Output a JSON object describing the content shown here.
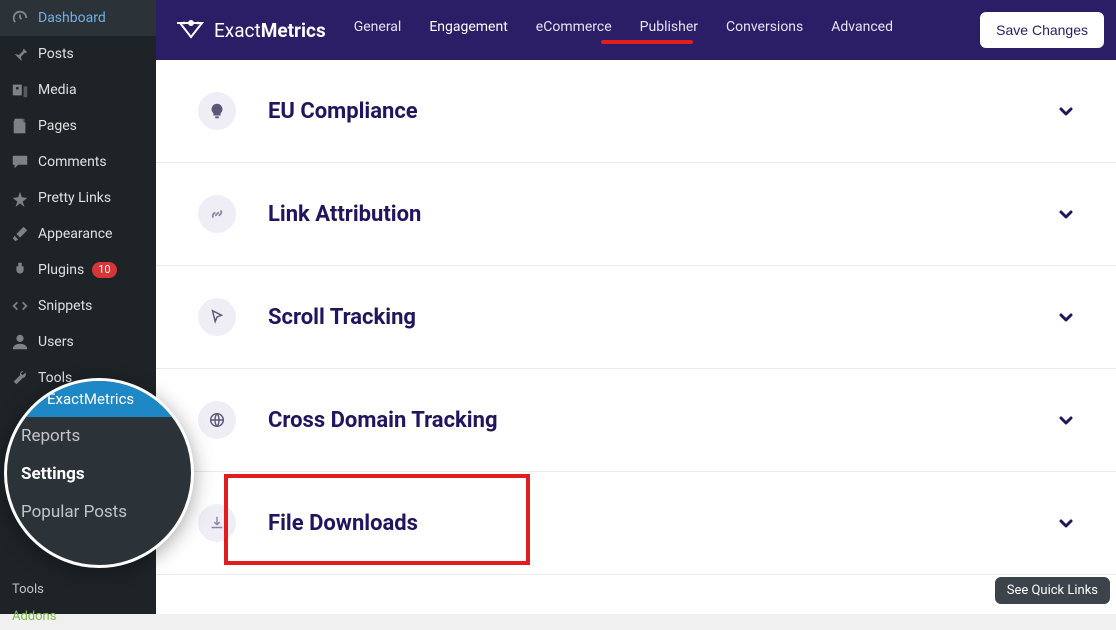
{
  "brand": {
    "prefix": "Exact",
    "suffix": "Metrics"
  },
  "topnav": {
    "tabs": [
      "General",
      "Engagement",
      "eCommerce",
      "Publisher",
      "Conversions",
      "Advanced"
    ],
    "active_index": 1,
    "save_label": "Save Changes"
  },
  "wp_sidebar": {
    "items": [
      {
        "label": "Dashboard",
        "icon": "dashboard"
      },
      {
        "label": "Posts",
        "icon": "pin"
      },
      {
        "label": "Media",
        "icon": "media"
      },
      {
        "label": "Pages",
        "icon": "page"
      },
      {
        "label": "Comments",
        "icon": "comment"
      },
      {
        "label": "Pretty Links",
        "icon": "star"
      },
      {
        "label": "Appearance",
        "icon": "brush"
      },
      {
        "label": "Plugins",
        "icon": "plug",
        "badge": "10"
      },
      {
        "label": "Snippets",
        "icon": "code"
      },
      {
        "label": "Users",
        "icon": "user"
      },
      {
        "label": "Tools",
        "icon": "wrench"
      }
    ],
    "sub": [
      {
        "label": "Tools"
      },
      {
        "label": "Addons",
        "class": "addons"
      }
    ]
  },
  "lens": {
    "active": "ExactMetrics",
    "items": [
      {
        "label": "Reports"
      },
      {
        "label": "Settings",
        "current": true
      },
      {
        "label": "Popular Posts"
      }
    ]
  },
  "panels": [
    {
      "title": "EU Compliance",
      "icon": "bulb"
    },
    {
      "title": "Link Attribution",
      "icon": "link"
    },
    {
      "title": "Scroll Tracking",
      "icon": "cursor"
    },
    {
      "title": "Cross Domain Tracking",
      "icon": "globe"
    },
    {
      "title": "File Downloads",
      "icon": "download",
      "highlight": true
    }
  ],
  "quick_links_label": "See Quick Links"
}
